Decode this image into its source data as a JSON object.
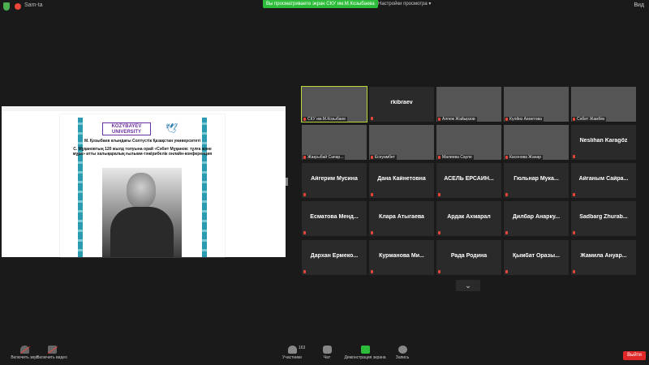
{
  "topbar": {
    "user": "Sam-ta",
    "viewing_banner": "Вы просматриваете экран СКУ им.М.Козыбаева",
    "view_options": "Настройки просмотра",
    "view_button": "Вид"
  },
  "shared_doc": {
    "logo_text": "KOZYBAYEV UNIVERSITY",
    "university": "М. Қозыбаев атындағы Солтүстік Қазақстан университеті",
    "title": "С. Мұқановтың 120 жылд толуына орай «Сәбит Мұқанов: тұлға және мұра» атты халықаралық ғылыми-тәжірибелік онлайн-конференция"
  },
  "participants": [
    {
      "name": "СКУ им.М.Козыбаев",
      "video": true
    },
    {
      "name": "rkibraev",
      "video": false
    },
    {
      "name": "Алпеж Жайырзов",
      "video": true
    },
    {
      "name": "Күлйиз Ахметова",
      "video": true
    },
    {
      "name": "Сәбит Жамбек",
      "video": true
    },
    {
      "name": "Жақсыбай Сапар...",
      "video": true
    },
    {
      "name": "Есеуамбет",
      "video": true
    },
    {
      "name": "Малиева Сауле",
      "video": true
    },
    {
      "name": "Касенова Жанар",
      "video": true
    },
    {
      "name": "Neslihan Karagöz",
      "video": false
    },
    {
      "name": "Айгерим Мусина",
      "video": false
    },
    {
      "name": "Дана Кайнетовна",
      "video": false
    },
    {
      "name": "АСЕЛЬ ЕРСАИН...",
      "video": false
    },
    {
      "name": "Гюльнар Мука...",
      "video": false
    },
    {
      "name": "Айганым Сайра...",
      "video": false
    },
    {
      "name": "Есматова Менд...",
      "video": false
    },
    {
      "name": "Клара Атыгаева",
      "video": false
    },
    {
      "name": "Ардак Ахмарал",
      "video": false
    },
    {
      "name": "Дилбар Анарку...",
      "video": false
    },
    {
      "name": "Sadbarg Zhurab...",
      "video": false
    },
    {
      "name": "Дархан Ермеко...",
      "video": false
    },
    {
      "name": "Курманова Ми...",
      "video": false
    },
    {
      "name": "Рада Родина",
      "video": false
    },
    {
      "name": "Қымбат Оразы...",
      "video": false
    },
    {
      "name": "Жамила Ануар...",
      "video": false
    }
  ],
  "toolbar": {
    "unmute": "Включить звук",
    "start_video": "Включить видео",
    "participants": "Участники",
    "participants_count": "163",
    "chat": "Чат",
    "share": "Демонстрация экрана",
    "record": "Запись",
    "exit": "Выйти"
  },
  "colors": {
    "share_green": "#2dbd3a",
    "exit_red": "#e02828",
    "active_speaker": "#b7d93c"
  }
}
